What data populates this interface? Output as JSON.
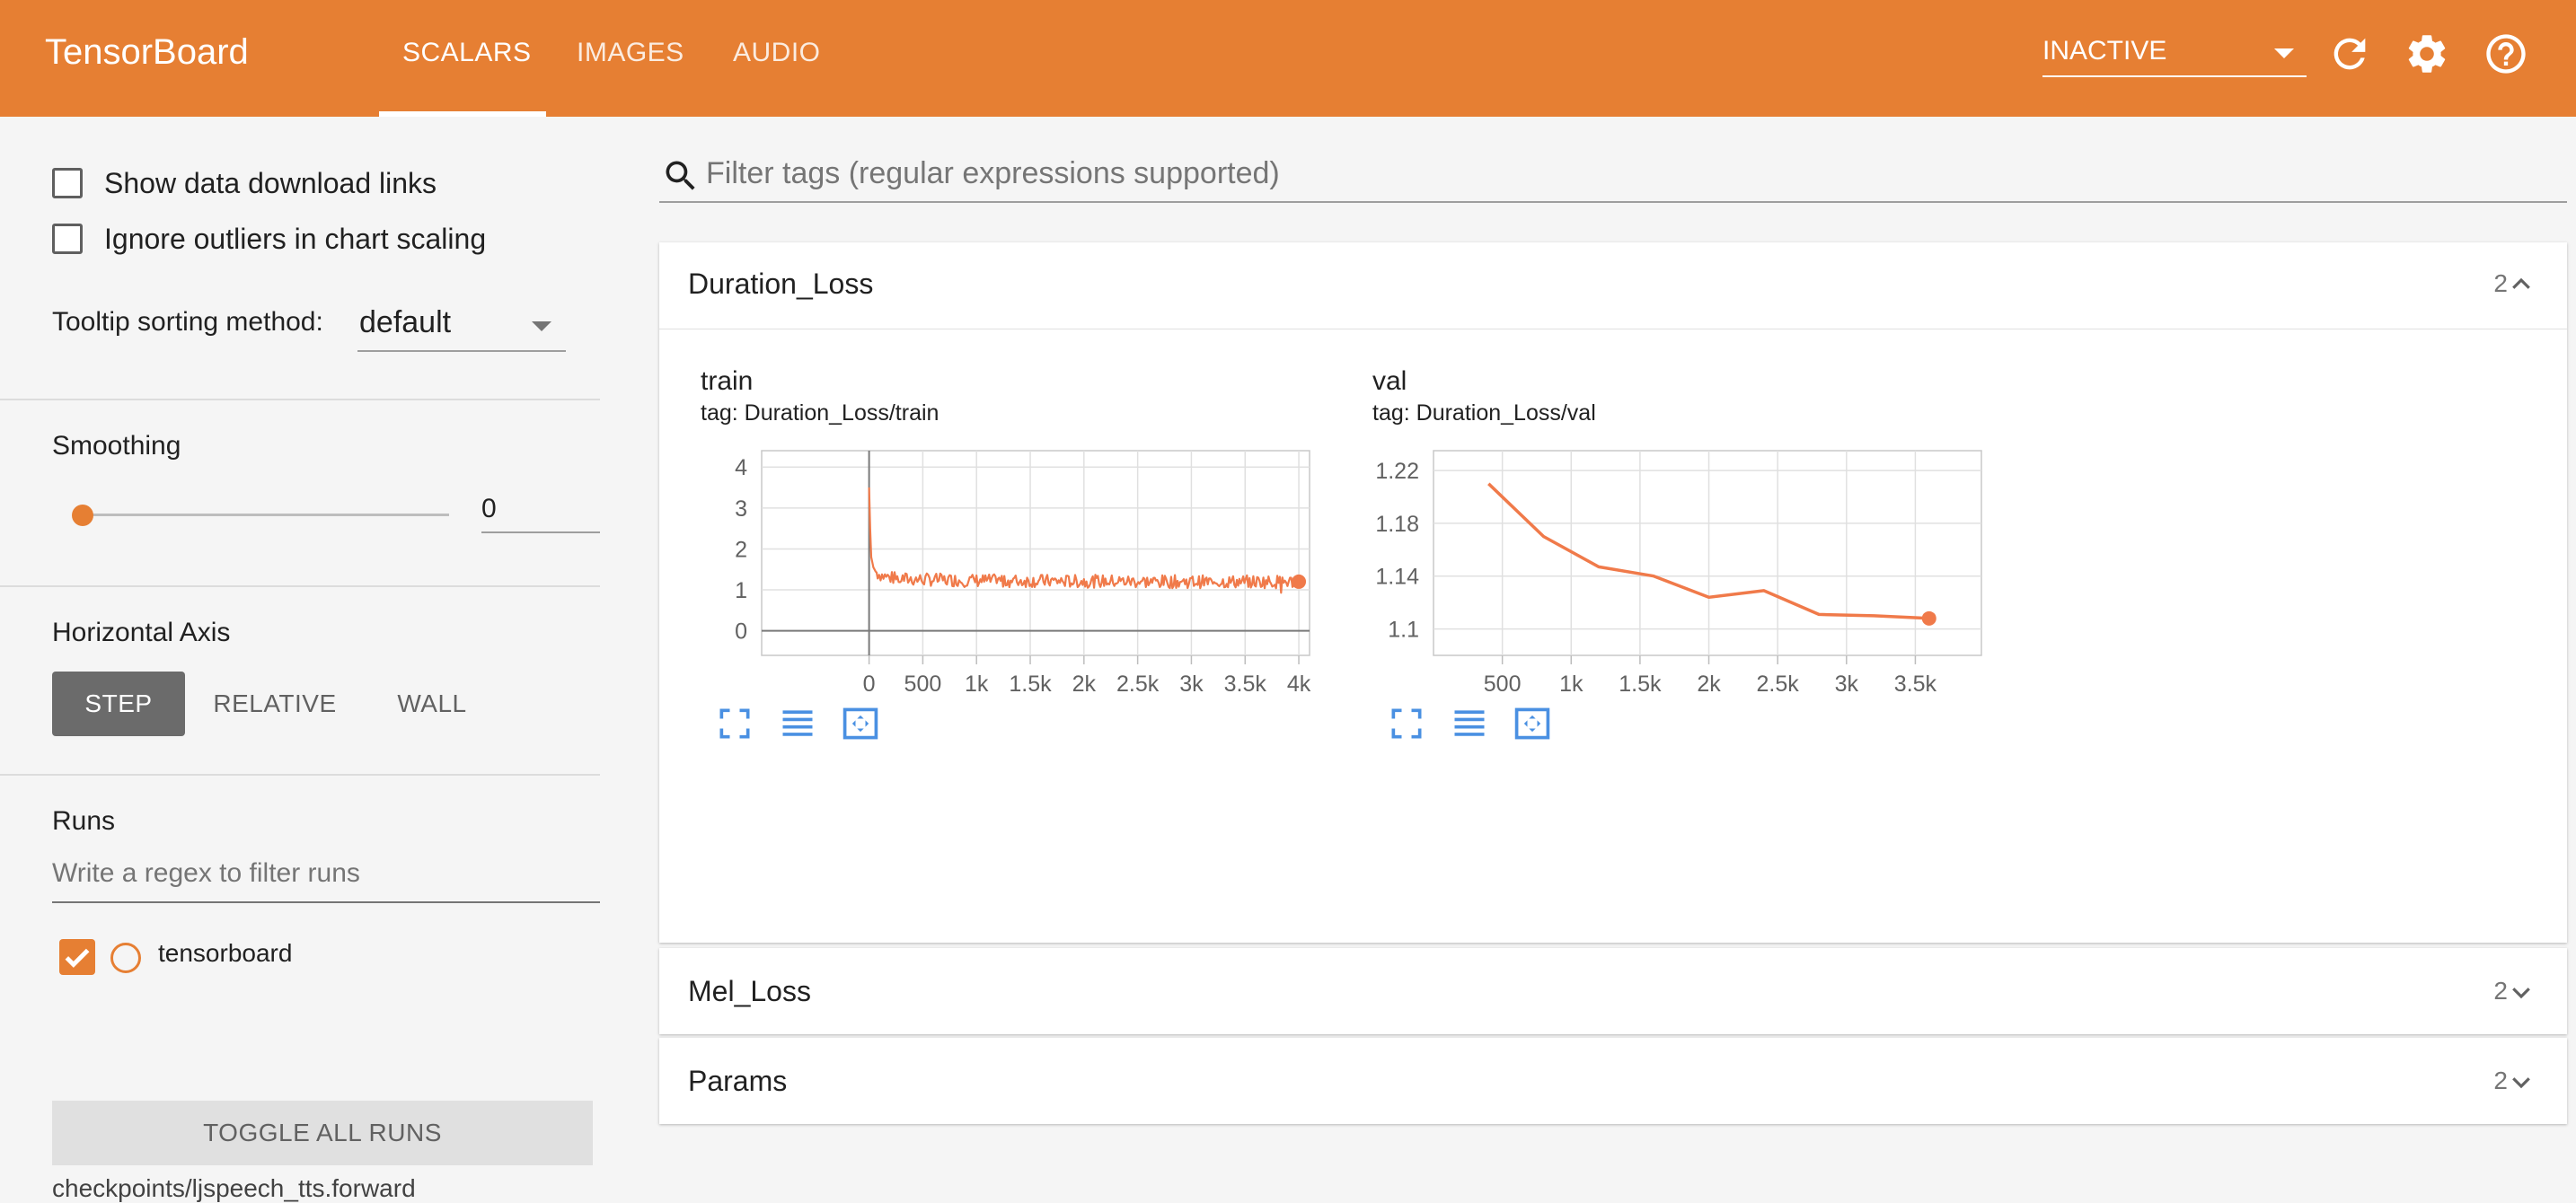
{
  "header": {
    "brand": "TensorBoard",
    "tabs": [
      {
        "label": "SCALARS",
        "active": true
      },
      {
        "label": "IMAGES",
        "active": false
      },
      {
        "label": "AUDIO",
        "active": false
      }
    ],
    "reload_status": "INACTIVE",
    "icons": [
      "refresh-icon",
      "settings-icon",
      "help-icon"
    ]
  },
  "sidebar": {
    "show_download_links": "Show data download links",
    "ignore_outliers": "Ignore outliers in chart scaling",
    "tooltip_label": "Tooltip sorting method:",
    "tooltip_value": "default",
    "smoothing_title": "Smoothing",
    "smoothing_value": "0",
    "horizontal_axis_title": "Horizontal Axis",
    "axis_options": [
      "STEP",
      "RELATIVE",
      "WALL"
    ],
    "runs_title": "Runs",
    "runs_filter_placeholder": "Write a regex to filter runs",
    "run_name": "tensorboard",
    "toggle_all": "TOGGLE ALL RUNS",
    "run_path": "checkpoints/ljspeech_tts.forward"
  },
  "main": {
    "filter_placeholder": "Filter tags (regular expressions supported)",
    "cards": [
      {
        "title": "Duration_Loss",
        "count": "2",
        "expanded": true
      },
      {
        "title": "Mel_Loss",
        "count": "2",
        "expanded": false
      },
      {
        "title": "Params",
        "count": "2",
        "expanded": false
      }
    ]
  },
  "colors": {
    "accent": "#e67f33",
    "series": "#f07a4a",
    "grid": "#e0e0e0",
    "tool_icon": "#4a90e2"
  },
  "chart_data": [
    {
      "type": "line",
      "title": "train",
      "tag": "tag: Duration_Loss/train",
      "xlim": [
        -1000,
        4100
      ],
      "ylim": [
        -0.6,
        4.4
      ],
      "x_ticks": [
        0,
        500,
        1000,
        1500,
        2000,
        2500,
        3000,
        3500,
        4000
      ],
      "x_tick_labels": [
        "0",
        "500",
        "1k",
        "1.5k",
        "2k",
        "2.5k",
        "3k",
        "3.5k",
        "4k"
      ],
      "y_ticks": [
        0,
        1,
        2,
        3,
        4
      ],
      "y_tick_labels": [
        "0",
        "1",
        "2",
        "3",
        "4"
      ],
      "series": [
        {
          "name": "tensorboard",
          "x": [
            0,
            10,
            20,
            40,
            60,
            80,
            120,
            160,
            200,
            250,
            300,
            400,
            500,
            600,
            700,
            800,
            900,
            1000,
            1200,
            1400,
            1600,
            1800,
            2000,
            2200,
            2400,
            2600,
            2800,
            3000,
            3200,
            3400,
            3600,
            3800,
            4000
          ],
          "y": [
            3.5,
            2.5,
            1.8,
            1.55,
            1.45,
            1.4,
            1.35,
            1.32,
            1.3,
            1.28,
            1.27,
            1.26,
            1.25,
            1.25,
            1.24,
            1.24,
            1.23,
            1.23,
            1.22,
            1.22,
            1.22,
            1.21,
            1.21,
            1.21,
            1.21,
            1.2,
            1.2,
            1.2,
            1.2,
            1.2,
            1.2,
            1.2,
            1.2
          ]
        }
      ]
    },
    {
      "type": "line",
      "title": "val",
      "tag": "tag: Duration_Loss/val",
      "xlim": [
        0,
        3980
      ],
      "ylim": [
        1.08,
        1.235
      ],
      "x_ticks": [
        500,
        1000,
        1500,
        2000,
        2500,
        3000,
        3500
      ],
      "x_tick_labels": [
        "500",
        "1k",
        "1.5k",
        "2k",
        "2.5k",
        "3k",
        "3.5k"
      ],
      "y_ticks": [
        1.1,
        1.14,
        1.18,
        1.22
      ],
      "y_tick_labels": [
        "1.1",
        "1.14",
        "1.18",
        "1.22"
      ],
      "series": [
        {
          "name": "tensorboard",
          "x": [
            400,
            800,
            1200,
            1600,
            2000,
            2400,
            2800,
            3200,
            3600
          ],
          "y": [
            1.21,
            1.17,
            1.147,
            1.14,
            1.124,
            1.129,
            1.111,
            1.11,
            1.108
          ]
        }
      ]
    }
  ]
}
